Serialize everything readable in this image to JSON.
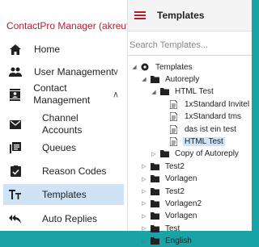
{
  "sidebar": {
    "app_title": "ContactPro Manager (akreuter)",
    "items": [
      {
        "label": "Home",
        "icon": "home-icon"
      },
      {
        "label": "User Management",
        "icon": "users-icon"
      },
      {
        "label": "Contact Management",
        "icon": "contacts-icon"
      },
      {
        "label": "Channel Accounts",
        "icon": "mail-icon"
      },
      {
        "label": "Queues",
        "icon": "queue-icon"
      },
      {
        "label": "Reason Codes",
        "icon": "checkbox-icon"
      },
      {
        "label": "Templates",
        "icon": "text-format-icon"
      },
      {
        "label": "Auto Replies",
        "icon": "reply-all-icon"
      }
    ]
  },
  "header": {
    "title": "Templates"
  },
  "search": {
    "placeholder": "Search Templates..."
  },
  "tree": [
    {
      "label": "Templates",
      "type": "root",
      "expanded": true
    },
    {
      "label": "Autoreply",
      "type": "folder",
      "expanded": true
    },
    {
      "label": "HTML Test",
      "type": "folder",
      "expanded": true
    },
    {
      "label": "1xStandard Invitel",
      "type": "file"
    },
    {
      "label": "1xStandard tms",
      "type": "file"
    },
    {
      "label": "das ist ein test",
      "type": "file"
    },
    {
      "label": "HTML Test",
      "type": "file",
      "selected": true
    },
    {
      "label": "Copy of Autoreply",
      "type": "folder",
      "expanded": false
    },
    {
      "label": "Test2",
      "type": "folder",
      "expanded": false
    },
    {
      "label": "Vorlagen",
      "type": "folder",
      "expanded": false
    },
    {
      "label": "Test2",
      "type": "folder",
      "expanded": false
    },
    {
      "label": "Vorlagen2",
      "type": "folder",
      "expanded": false
    },
    {
      "label": "Vorlagen",
      "type": "folder",
      "expanded": false
    },
    {
      "label": "Test",
      "type": "folder",
      "expanded": false
    },
    {
      "label": "English",
      "type": "folder",
      "expanded": false
    }
  ],
  "colors": {
    "background": "#1aa3a7",
    "brand": "#b01f2e",
    "selection": "#cfe3f4"
  }
}
